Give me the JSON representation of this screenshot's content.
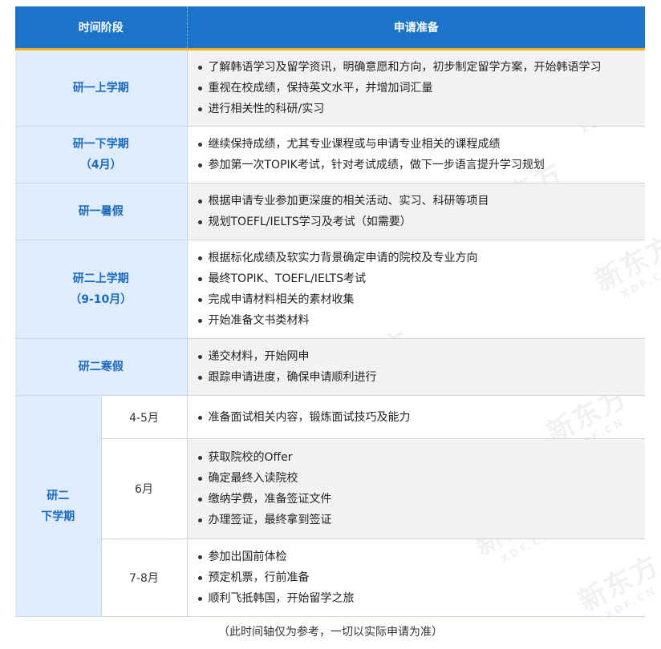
{
  "header": {
    "col1": "时间阶段",
    "col2": "申请准备"
  },
  "rows": [
    {
      "stage": "研一上学期",
      "items": [
        "了解韩语学习及留学资讯，明确意愿和方向，初步制定留学方案，开始韩语学习",
        "重视在校成绩，保持英文水平，并增加词汇量",
        "进行相关性的科研/实习"
      ]
    },
    {
      "stage": "研一下学期",
      "stage2": "（4月）",
      "items": [
        "继续保持成绩，尤其专业课程或与申请专业相关的课程成绩",
        "参加第一次TOPIK考试，针对考试成绩，做下一步语言提升学习规划"
      ]
    },
    {
      "stage": "研一暑假",
      "items": [
        "根据申请专业参加更深度的相关活动、实习、科研等项目",
        "规划TOEFL/IELTS学习及考试（如需要）"
      ]
    },
    {
      "stage": "研二上学期",
      "stage2": "（9-10月）",
      "items": [
        "根据标化成绩及软实力背景确定申请的院校及专业方向",
        "最终TOPIK、TOEFL/IELTS考试",
        "完成申请材料相关的素材收集",
        "开始准备文书类材料"
      ]
    },
    {
      "stage": "研二寒假",
      "items": [
        "递交材料，开始网申",
        "跟踪申请进度，确保申请顺利进行"
      ]
    }
  ],
  "final": {
    "stage": "研二",
    "stage2": "下学期",
    "subs": [
      {
        "period": "4-5月",
        "items": [
          "准备面试相关内容，锻炼面试技巧及能力"
        ]
      },
      {
        "period": "6月",
        "items": [
          "获取院校的Offer",
          "确定最终入读院校",
          "缴纳学费，准备签证文件",
          "办理签证，最终拿到签证"
        ]
      },
      {
        "period": "7-8月",
        "items": [
          "参加出国前体检",
          "预定机票，行前准备",
          "顺利飞抵韩国，开始留学之旅"
        ]
      }
    ]
  },
  "note": "（此时间轴仅为参考，一切以实际申请为准）",
  "watermark": {
    "text": "新东方",
    "sub": "XDF.CN"
  }
}
